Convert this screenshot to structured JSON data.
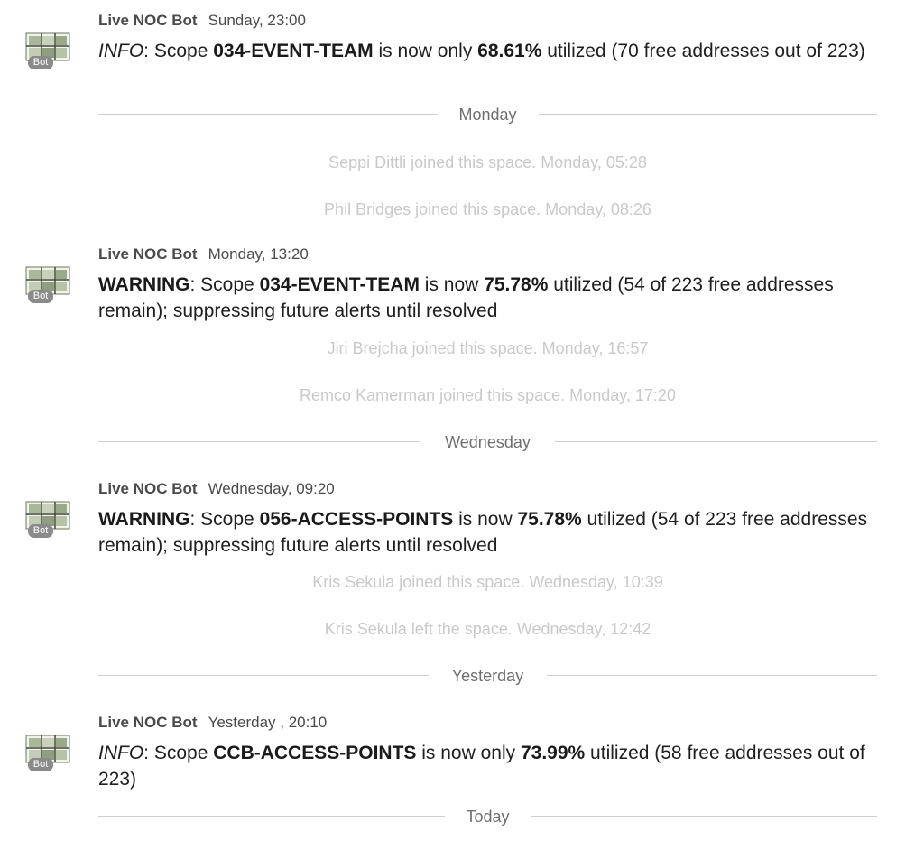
{
  "feed": {
    "messages": [
      {
        "sender": "Live NOC Bot",
        "timestamp": "Sunday, 23:00",
        "avatar_badge": "Bot",
        "level": "INFO",
        "pre_scope": ": Scope ",
        "scope": "034-EVENT-TEAM",
        "mid": " is now only ",
        "percent": "68.61%",
        "tail": " utilized (70 free addresses out of 223)"
      },
      {
        "sender": "Live NOC Bot",
        "timestamp": "Monday, 13:20",
        "avatar_badge": "Bot",
        "level": "WARNING",
        "pre_scope": ": Scope ",
        "scope": "034-EVENT-TEAM",
        "mid": " is now ",
        "percent": "75.78%",
        "tail": " utilized (54 of 223 free addresses remain); suppressing future alerts until resolved"
      },
      {
        "sender": "Live NOC Bot",
        "timestamp": "Wednesday, 09:20",
        "avatar_badge": "Bot",
        "level": "WARNING",
        "pre_scope": ": Scope ",
        "scope": "056-ACCESS-POINTS",
        "mid": " is now ",
        "percent": "75.78%",
        "tail": " utilized (54 of 223 free addresses remain); suppressing future alerts until resolved"
      },
      {
        "sender": "Live NOC Bot",
        "timestamp": "Yesterday , 20:10",
        "avatar_badge": "Bot",
        "level": "INFO",
        "pre_scope": ": Scope ",
        "scope": "CCB-ACCESS-POINTS",
        "mid": " is now only ",
        "percent": "73.99%",
        "tail": " utilized (58 free addresses out of 223)"
      }
    ],
    "dividers": [
      "Monday",
      "Wednesday",
      "Yesterday",
      "Today"
    ],
    "system_events": [
      "Seppi Dittli joined this space. Monday, 05:28",
      "Phil Bridges joined this space. Monday, 08:26",
      "Jiri Brejcha joined this space. Monday, 16:57",
      "Remco Kamerman joined this space. Monday, 17:20",
      "Kris Sekula joined this space. Wednesday, 10:39",
      "Kris Sekula left the space. Wednesday, 12:42"
    ]
  },
  "colors": {
    "text": "#1f1f1f",
    "meta": "#4a4a4a",
    "divider_line": "#cfcfcf",
    "divider_label": "#6f6f6f",
    "system_text": "#c9c9c9"
  },
  "icons": {
    "avatar": "noc-dashboard-avatar-icon"
  }
}
